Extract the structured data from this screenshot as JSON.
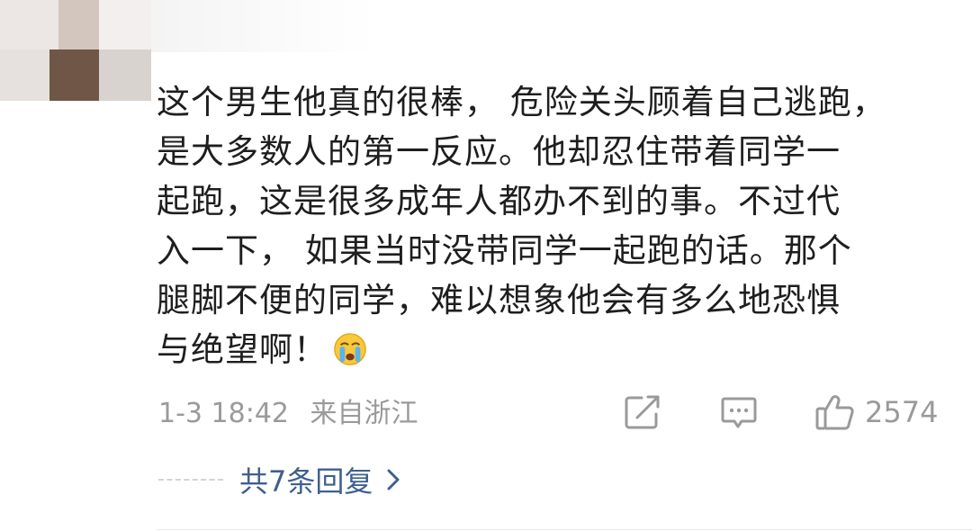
{
  "comment": {
    "text": "这个男生他真的很棒， 危险关头顾着自己逃跑，\n是大多数人的第一反应。他却忍住带着同学一\n起跑，这是很多成年人都办不到的事。不过代\n入一下， 如果当时没带同学一起跑的话。那个\n腿脚不便的同学，难以想象他会有多么地恐惧\n与绝望啊！",
    "emoji": "crying-face-emoji"
  },
  "meta": {
    "time": "1-3 18:42",
    "location": "来自浙江"
  },
  "actions": {
    "share_icon": "share-icon",
    "comment_icon": "comment-icon",
    "like_icon": "thumbs-up-icon",
    "like_count": "2574"
  },
  "replies": {
    "label": "共7条回复"
  },
  "colors": {
    "text": "#1e1e1e",
    "meta": "#9a9a9a",
    "link": "#3f5f90"
  }
}
